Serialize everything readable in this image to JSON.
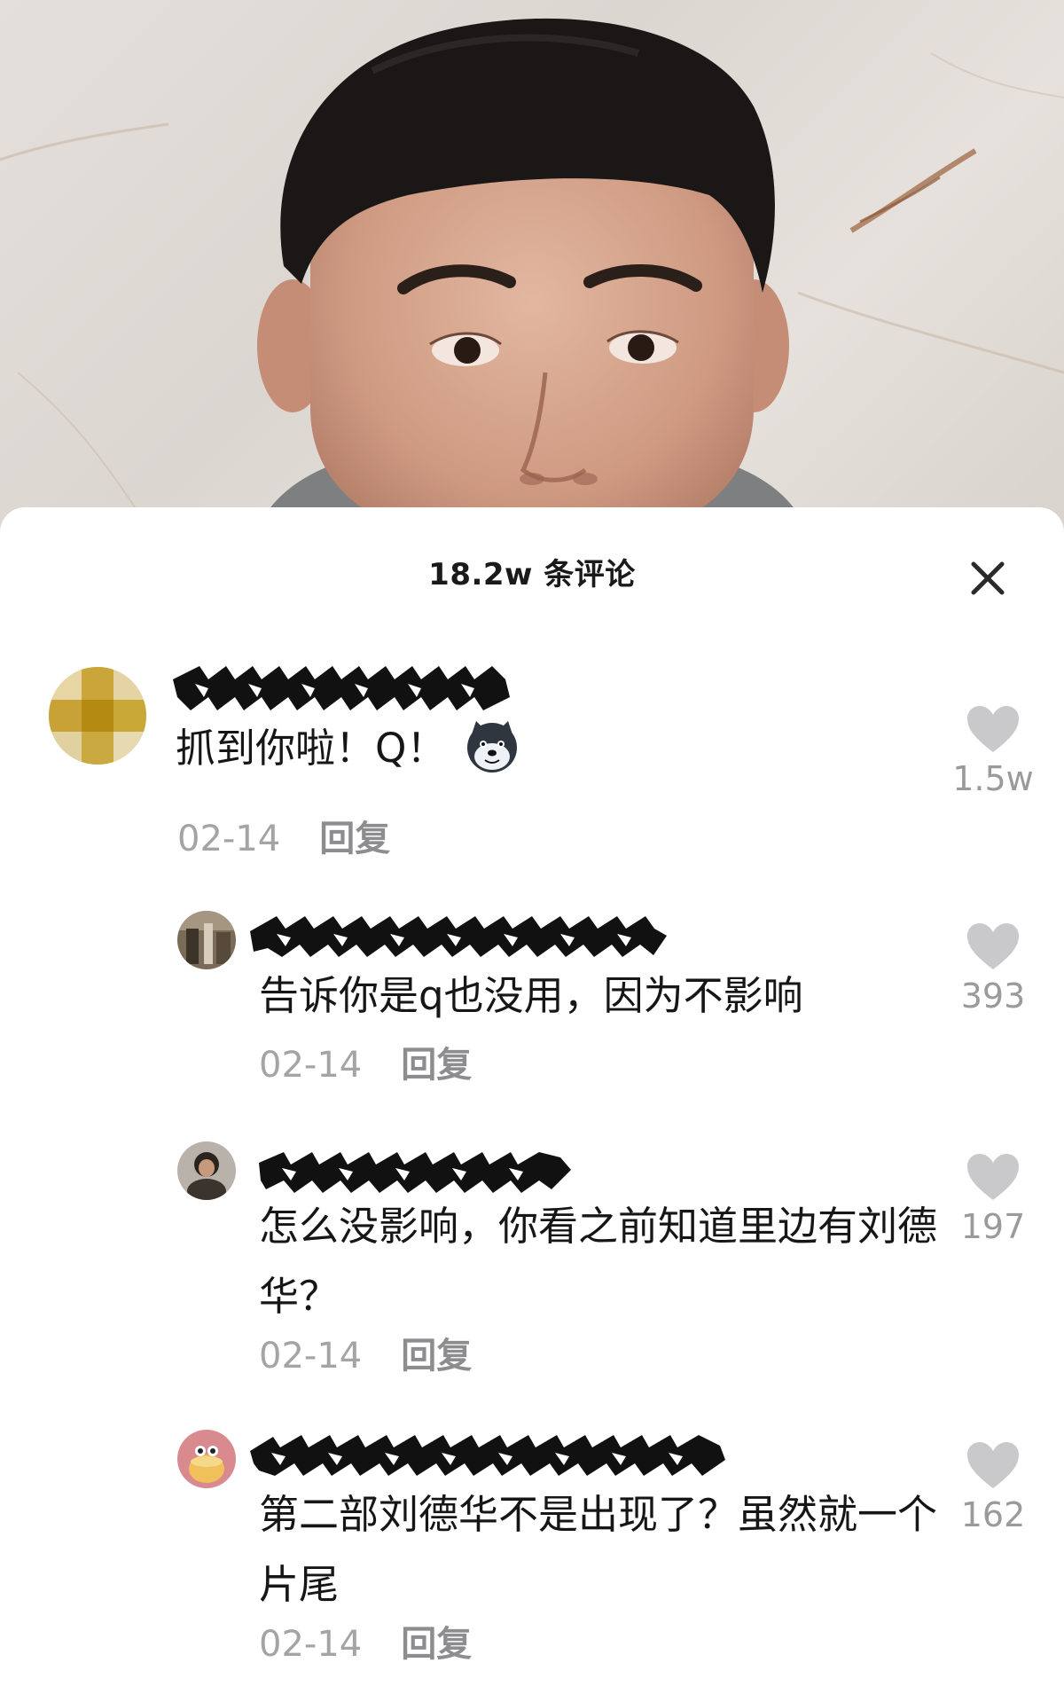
{
  "header": {
    "title": "18.2w 条评论"
  },
  "colors": {
    "accent_gray": "#8d8d90",
    "like_gray": "#c6c6c8",
    "text": "#161616"
  },
  "icons": {
    "close": "close-icon",
    "like": "heart-icon"
  },
  "comments": [
    {
      "text": "抓到你啦！Q！",
      "emoji": "husky-emoji",
      "date": "02-14",
      "reply_label": "回复",
      "likes": "1.5w",
      "username_obscured": true
    },
    {
      "text": "告诉你是q也没用，因为不影响",
      "date": "02-14",
      "reply_label": "回复",
      "likes": "393",
      "username_obscured": true
    },
    {
      "text": "怎么没影响，你看之前知道里边有刘德华？",
      "date": "02-14",
      "reply_label": "回复",
      "likes": "197",
      "username_obscured": true
    },
    {
      "text": "第二部刘德华不是出现了？虽然就一个片尾",
      "date": "02-14",
      "reply_label": "回复",
      "likes": "162",
      "username_obscured": true
    }
  ]
}
